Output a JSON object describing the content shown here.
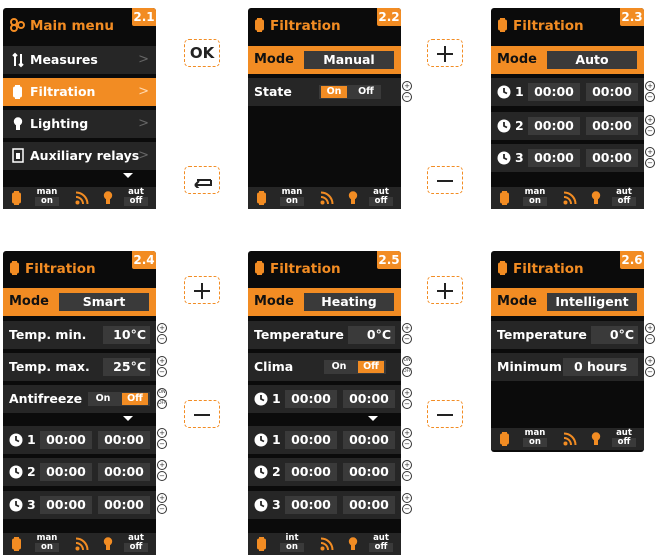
{
  "colors": {
    "accent": "#f28c23",
    "screen_bg": "#0b0b0b",
    "row_bg": "#262626",
    "value_bg": "#3a3a3a"
  },
  "screen_2_1": {
    "badge": "2.1",
    "title": "Main menu",
    "items": [
      {
        "label": "Measures",
        "icon": "measures-icon"
      },
      {
        "label": "Filtration",
        "icon": "pump-icon"
      },
      {
        "label": "Lighting",
        "icon": "bulb-icon"
      },
      {
        "label": "Auxiliary relays",
        "icon": "relay-icon"
      }
    ],
    "footer": {
      "pump_top": "man",
      "pump_bottom": "on",
      "light_top": "aut",
      "light_bottom": "off"
    }
  },
  "screen_2_2": {
    "badge": "2.2",
    "title": "Filtration",
    "mode_label": "Mode",
    "mode_value": "Manual",
    "state_label": "State",
    "on": "On",
    "off": "Off",
    "footer": {
      "pump_top": "man",
      "pump_bottom": "on",
      "light_top": "aut",
      "light_bottom": "off"
    }
  },
  "screen_2_3": {
    "badge": "2.3",
    "title": "Filtration",
    "mode_label": "Mode",
    "mode_value": "Auto",
    "timers": [
      {
        "n": "1",
        "start": "00:00",
        "end": "00:00"
      },
      {
        "n": "2",
        "start": "00:00",
        "end": "00:00"
      },
      {
        "n": "3",
        "start": "00:00",
        "end": "00:00"
      }
    ],
    "footer": {
      "pump_top": "man",
      "pump_bottom": "on",
      "light_top": "aut",
      "light_bottom": "off"
    }
  },
  "screen_2_4": {
    "badge": "2.4",
    "title": "Filtration",
    "mode_label": "Mode",
    "mode_value": "Smart",
    "temp_min_label": "Temp. min.",
    "temp_min_value": "10°C",
    "temp_max_label": "Temp. max.",
    "temp_max_value": "25°C",
    "antifreeze_label": "Antifreeze",
    "on": "On",
    "off": "Off",
    "timers": [
      {
        "n": "1",
        "start": "00:00",
        "end": "00:00"
      },
      {
        "n": "2",
        "start": "00:00",
        "end": "00:00"
      },
      {
        "n": "3",
        "start": "00:00",
        "end": "00:00"
      }
    ],
    "footer": {
      "pump_top": "man",
      "pump_bottom": "on",
      "light_top": "aut",
      "light_bottom": "off"
    }
  },
  "screen_2_5": {
    "badge": "2.5",
    "title": "Filtration",
    "mode_label": "Mode",
    "mode_value": "Heating",
    "temperature_label": "Temperature",
    "temperature_value": "0°C",
    "clima_label": "Clima",
    "on": "On",
    "off": "Off",
    "timers": [
      {
        "n": "1",
        "start": "00:00",
        "end": "00:00"
      },
      {
        "n": "1",
        "start": "00:00",
        "end": "00:00"
      },
      {
        "n": "2",
        "start": "00:00",
        "end": "00:00"
      },
      {
        "n": "3",
        "start": "00:00",
        "end": "00:00"
      }
    ],
    "footer": {
      "pump_top": "int",
      "pump_bottom": "on",
      "light_top": "aut",
      "light_bottom": "off"
    }
  },
  "screen_2_6": {
    "badge": "2.6",
    "title": "Filtration",
    "mode_label": "Mode",
    "mode_value": "Intelligent",
    "temperature_label": "Temperature",
    "temperature_value": "0°C",
    "minimum_label": "Minimum",
    "minimum_value": "0 hours",
    "footer": {
      "pump_top": "man",
      "pump_bottom": "on",
      "light_top": "aut",
      "light_bottom": "off"
    }
  },
  "buttons": {
    "ok": "OK",
    "back": "back-arrow-icon",
    "plus": "plus-icon",
    "minus": "minus-icon"
  }
}
